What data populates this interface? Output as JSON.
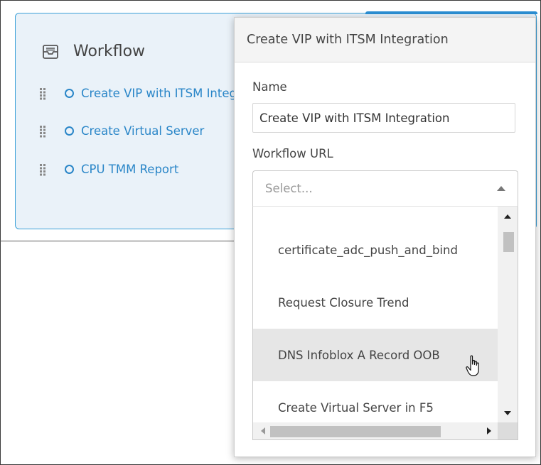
{
  "workflow_panel": {
    "title": "Workflow",
    "items": [
      {
        "label": "Create VIP with ITSM Integration"
      },
      {
        "label": "Create Virtual Server"
      },
      {
        "label": "CPU TMM Report"
      }
    ]
  },
  "popover": {
    "title": "Create VIP with ITSM Integration",
    "name_label": "Name",
    "name_value": "Create VIP with ITSM Integration",
    "url_label": "Workflow URL",
    "url_placeholder": "Select...",
    "options": [
      {
        "label": "certificate_adc_push_and_bind"
      },
      {
        "label": "Request Closure Trend"
      },
      {
        "label": "DNS Infoblox A Record OOB"
      },
      {
        "label": "Create Virtual Server in F5"
      }
    ]
  },
  "colors": {
    "accent": "#2a86c8",
    "card_background": "#eaf2f9",
    "card_border": "#3aa0d8",
    "hover_option": "#e6e6e6"
  },
  "icons": [
    "inbox-icon",
    "drag-handle-icon",
    "circle-icon",
    "caret-up-icon",
    "hand-pointer-cursor"
  ]
}
